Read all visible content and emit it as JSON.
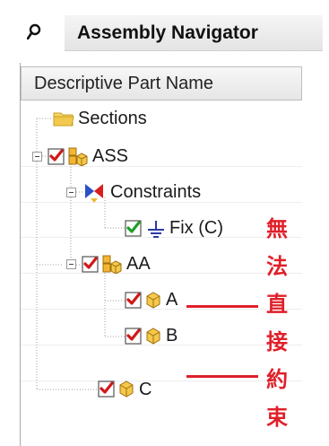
{
  "titlebar": {
    "title": "Assembly Navigator",
    "pin_icon": "pin-icon"
  },
  "columns": {
    "header": "Descriptive Part Name"
  },
  "tree": {
    "sections": {
      "label": "Sections",
      "icon": "folder-icon"
    },
    "ass": {
      "label": "ASS",
      "icon": "assembly-icon",
      "checked": true
    },
    "constraints": {
      "label": "Constraints",
      "icon": "constraints-icon"
    },
    "fix": {
      "label": "Fix (C)",
      "icon": "fix-constraint-icon",
      "checked": true
    },
    "aa": {
      "label": "AA",
      "icon": "assembly-icon",
      "checked": true
    },
    "a": {
      "label": "A",
      "icon": "part-cube-icon",
      "checked": true
    },
    "b": {
      "label": "B",
      "icon": "part-cube-icon",
      "checked": true
    },
    "c": {
      "label": "C",
      "icon": "part-cube-icon",
      "checked": true
    }
  },
  "annotation": {
    "chars": [
      "無",
      "法",
      "直",
      "接",
      "約",
      "束"
    ],
    "color": "#e0202a"
  },
  "colors": {
    "check_red": "#d01818",
    "check_green": "#1f9e2a",
    "folder_yellow": "#f2c94c",
    "cube_yellow": "#f2b632"
  }
}
